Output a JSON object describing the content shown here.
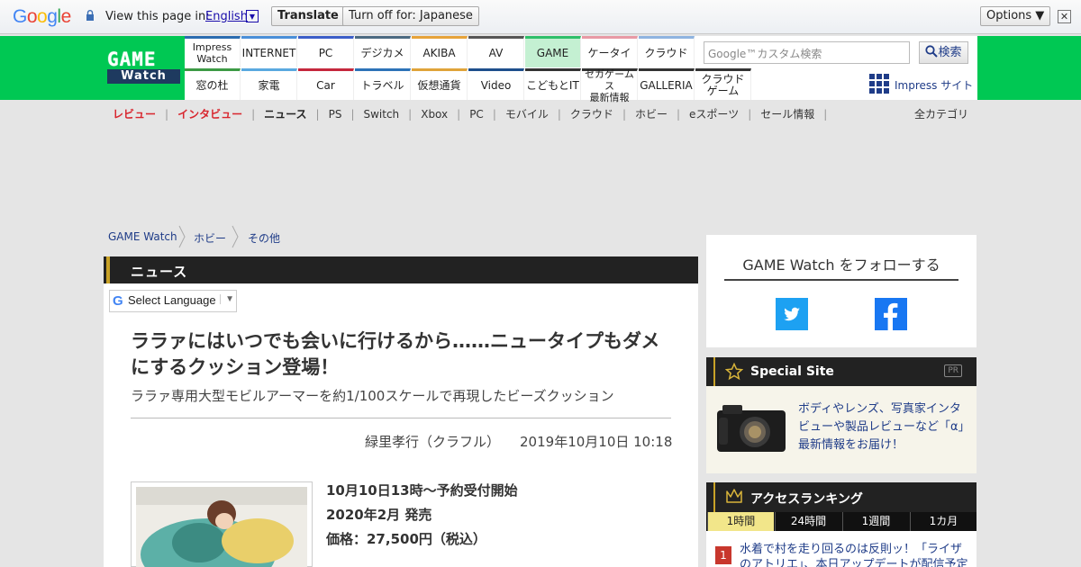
{
  "translate_bar": {
    "logo_letters": [
      "G",
      "o",
      "o",
      "g",
      "l",
      "e"
    ],
    "logo_colors": [
      "#4285f4",
      "#ea4335",
      "#fbbc05",
      "#4285f4",
      "#34a853",
      "#ea4335"
    ],
    "view_text": "View this page in:",
    "language": "English",
    "translate_button": "Translate",
    "turn_off_button": "Turn off for: Japanese",
    "options_button": "Options ▼",
    "close_glyph": "✕"
  },
  "header": {
    "logo_top": "GAME",
    "logo_bottom": "Watch",
    "brand_color": "#00c853",
    "nav_top": [
      {
        "label": "Impress Watch",
        "color": "#2b6cb0"
      },
      {
        "label": "INTERNET",
        "color": "#4a8fd8"
      },
      {
        "label": "PC",
        "color": "#3b5ec8"
      },
      {
        "label": "デジカメ",
        "color": "#4b6a82"
      },
      {
        "label": "AKIBA",
        "color": "#e6a33a"
      },
      {
        "label": "AV",
        "color": "#555555"
      },
      {
        "label": "GAME",
        "color": "#2fbf6a",
        "active": true
      },
      {
        "label": "ケータイ",
        "color": "#e89aa5"
      },
      {
        "label": "クラウド",
        "color": "#8fb4e0"
      }
    ],
    "nav_bottom": [
      {
        "label": "窓の杜",
        "color": "#3d9a45"
      },
      {
        "label": "家電",
        "color": "#5aa9e0"
      },
      {
        "label": "Car",
        "color": "#c5283d"
      },
      {
        "label": "トラベル",
        "color": "#2d73b8"
      },
      {
        "label": "仮想通貨",
        "color": "#e0a43a"
      },
      {
        "label": "Video",
        "color": "#1e4f8c"
      },
      {
        "label": "こどもとIT",
        "color": "#333333"
      },
      {
        "label": "セガゲームス 最新情報",
        "color": "#333333"
      },
      {
        "label": "GALLERIA",
        "color": "#333333"
      },
      {
        "label": "クラウド ゲーム",
        "color": "#333333"
      }
    ],
    "search_placeholder": "Google™カスタム検索",
    "search_button": "検索",
    "impress_site": "Impress サイト"
  },
  "category_nav": {
    "items": [
      {
        "label": "レビュー",
        "red": true
      },
      {
        "label": "インタビュー",
        "red": true
      },
      {
        "label": "ニュース",
        "bold": true
      },
      {
        "label": "PS"
      },
      {
        "label": "Switch"
      },
      {
        "label": "Xbox"
      },
      {
        "label": "PC"
      },
      {
        "label": "モバイル"
      },
      {
        "label": "クラウド"
      },
      {
        "label": "ホビー"
      },
      {
        "label": "eスポーツ"
      },
      {
        "label": "セール情報"
      }
    ],
    "separator": "|",
    "all_categories": "全カテゴリ"
  },
  "breadcrumb": [
    "GAME Watch",
    "ホビー",
    "その他"
  ],
  "main": {
    "section_label": "ニュース",
    "select_language": "Select Language",
    "select_language_arrow": "▼",
    "title": "ララァにはいつでも会いに行けるから……ニュータイプもダメにするクッション登場！",
    "subtitle": "ララァ専用大型モビルアーマーを約1/100スケールで再現したビーズクッション",
    "author": "緑里孝行（クラフル）",
    "date": "2019年10月10日 10:18",
    "info_lines": [
      "10月10日13時～予約受付開始",
      "2020年2月 発売",
      "価格：27,500円（税込）"
    ]
  },
  "sidebar": {
    "follow_title": "GAME Watch をフォローする",
    "special_site": {
      "label": "Special Site",
      "pr": "PR",
      "text": "ボディやレンズ、写真家インタビューや製品レビューなど「α」最新情報をお届け！"
    },
    "ranking": {
      "label": "アクセスランキング",
      "tabs": [
        "1時間",
        "24時間",
        "1週間",
        "1カ月"
      ],
      "active_tab": 0,
      "items": [
        {
          "rank": "1",
          "text": "水着で村を走り回るのは反則ッ！「ライザのアトリエ」、本日アップデートが配信予定が発表"
        }
      ]
    }
  }
}
